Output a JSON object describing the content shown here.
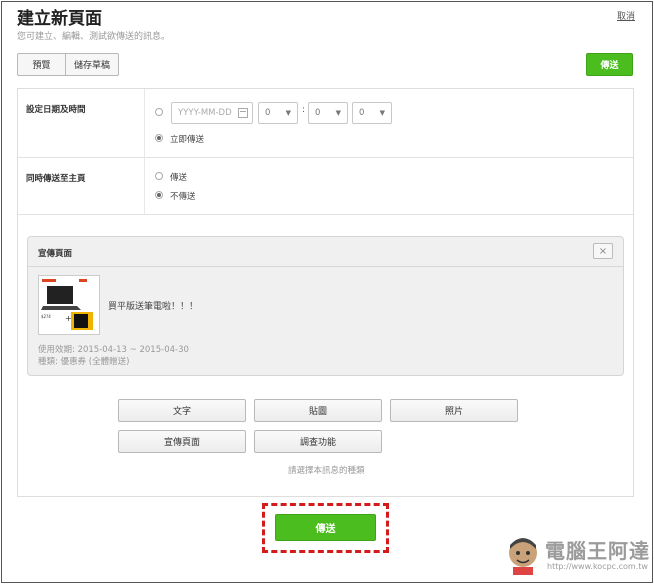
{
  "header": {
    "title": "建立新頁面",
    "subtitle": "您可建立、編輯、測試欲傳送的訊息。",
    "cancel_label": "取消"
  },
  "toolbar": {
    "preview_label": "預覽",
    "save_draft_label": "儲存草稿",
    "send_label": "傳送"
  },
  "schedule": {
    "label": "設定日期及時間",
    "date_placeholder": "YYYY-MM-DD",
    "hour_value": "0",
    "minute_value": "0",
    "second_value": "0",
    "colon": ":",
    "send_now_label": "立即傳送",
    "selected": "send_now"
  },
  "home_post": {
    "label": "同時傳送至主頁",
    "options": [
      "傳送",
      "不傳送"
    ],
    "selected": "不傳送"
  },
  "promo": {
    "title": "宣傳頁面",
    "close_icon": "close-icon",
    "message": "買平版送筆電啦！！！",
    "valid_period": "使用效期: 2015-04-13 ~ 2015-04-30",
    "type": "種類: 優惠券 (全體贈送)"
  },
  "content_types": {
    "buttons": [
      "文字",
      "貼圖",
      "照片",
      "宣傳頁面",
      "調查功能"
    ],
    "hint": "請選擇本訊息的種類"
  },
  "footer": {
    "send_label": "傳送"
  },
  "watermark": {
    "title": "電腦王阿達",
    "url": "http://www.kocpc.com.tw"
  },
  "colors": {
    "accent_green": "#4cbd1f",
    "highlight_red": "#d41b1b"
  }
}
